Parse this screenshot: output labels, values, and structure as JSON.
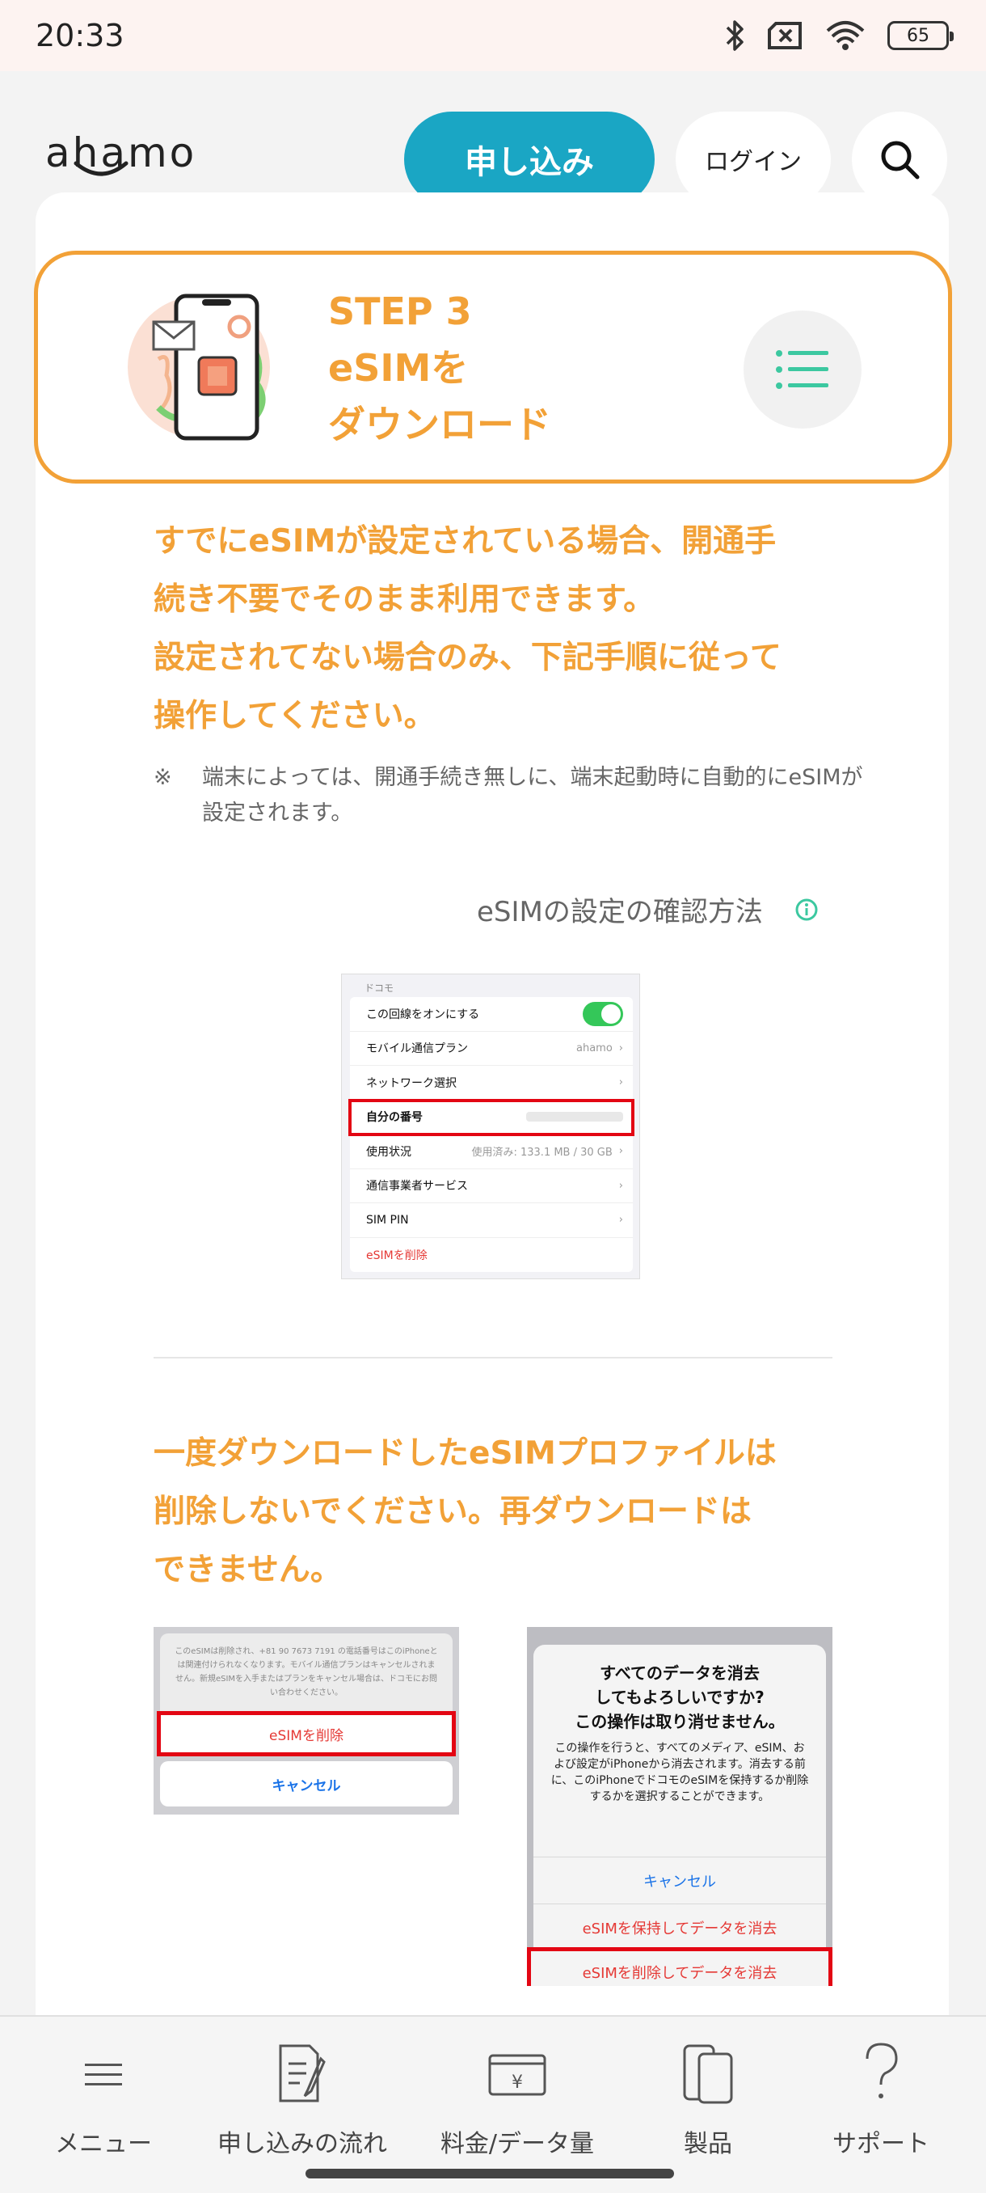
{
  "status_bar": {
    "time": "20:33",
    "battery": "65"
  },
  "header": {
    "logo": "ahamo",
    "apply_label": "申し込み",
    "login_label": "ログイン"
  },
  "step": {
    "line1": "STEP 3",
    "line2": "eSIMを",
    "line3": "ダウンロード"
  },
  "warning1": {
    "line1": "すでにeSIMが設定されている場合、開通手",
    "line2": "続き不要でそのまま利用できます。",
    "line3": "設定されてない場合のみ、下記手順に従って",
    "line4": "操作してください。"
  },
  "note": {
    "mark": "※",
    "text": "端末によっては、開通手続き無しに、端末起動時に自動的にeSIMが設定されます。"
  },
  "confirm_link": "eSIMの設定の確認方法",
  "settings_shot": {
    "carrier": "ドコモ",
    "rows": [
      {
        "label": "この回線をオンにする",
        "value": ""
      },
      {
        "label": "モバイル通信プラン",
        "value": "ahamo"
      },
      {
        "label": "ネットワーク選択",
        "value": ""
      },
      {
        "label": "自分の番号",
        "value": ""
      },
      {
        "label": "使用状況",
        "value": "使用済み: 133.1 MB / 30 GB"
      },
      {
        "label": "通信事業者サービス",
        "value": ""
      },
      {
        "label": "SIM PIN",
        "value": ""
      },
      {
        "label": "eSIMを削除",
        "value": ""
      }
    ]
  },
  "warning2": {
    "line1": "一度ダウンロードしたeSIMプロファイルは",
    "line2": "削除しないでください。再ダウンロードは",
    "line3": "できません。"
  },
  "delete_shot": {
    "message": "このeSIMは削除され、+81 90 7673 7191 の電話番号はこのiPhoneとは関連付けられなくなります。モバイル通信プランはキャンセルされません。新規eSIMを入手またはプランをキャンセル場合は、ドコモにお問い合わせください。",
    "delete_label": "eSIMを削除",
    "cancel_label": "キャンセル"
  },
  "erase_shot": {
    "title1": "すべてのデータを消去",
    "title2": "してもよろしいですか?",
    "title3": "この操作は取り消せません。",
    "body": "この操作を行うと、すべてのメディア、eSIM、および設定がiPhoneから消去されます。消去する前に、このiPhoneでドコモのeSIMを保持するか削除するかを選択することができます。",
    "cancel_label": "キャンセル",
    "keep_label": "eSIMを保持してデータを消去",
    "remove_label": "eSIMを削除してデータを消去"
  },
  "bottom_nav": {
    "menu": "メニュー",
    "flow": "申し込みの流れ",
    "price": "料金/データ量",
    "products": "製品",
    "support": "サポート"
  },
  "colors": {
    "accent": "#f2a137",
    "primary": "#1aa6c4",
    "highlight": "#e30613"
  }
}
